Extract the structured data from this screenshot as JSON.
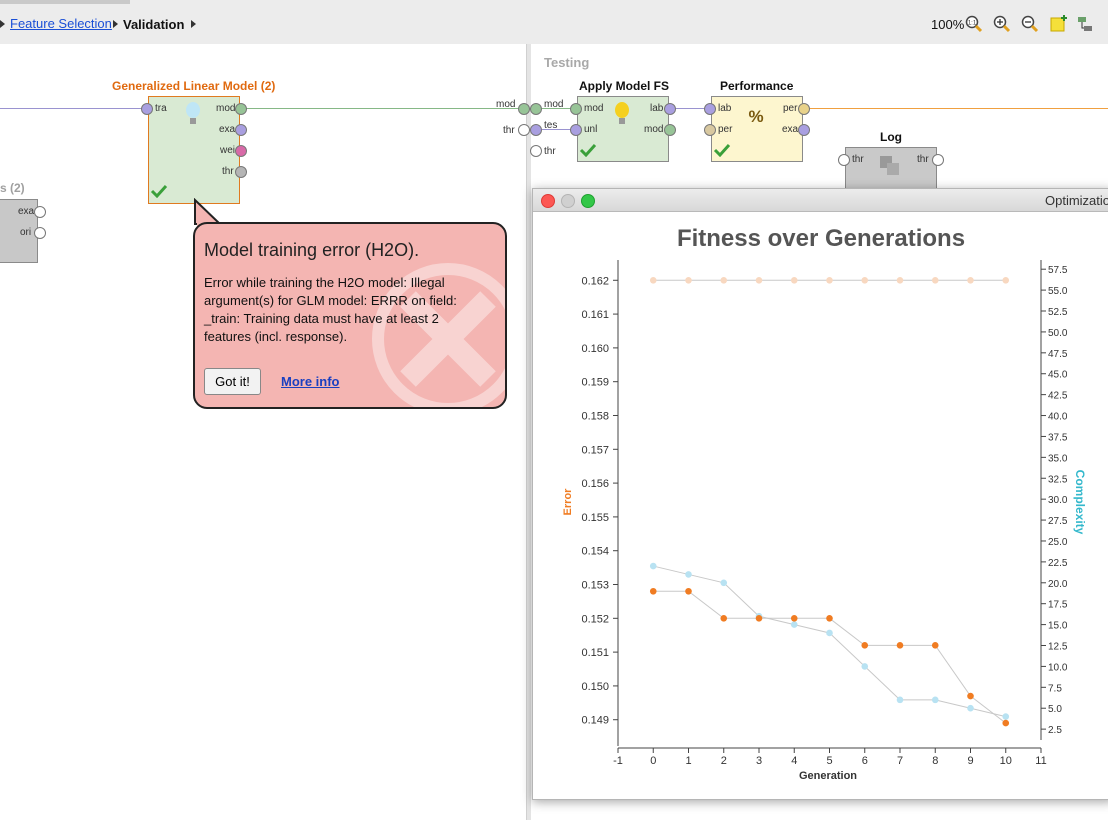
{
  "breadcrumb": {
    "link": "Feature Selection",
    "current": "Validation"
  },
  "toolbar": {
    "zoom": "100%",
    "zoom_badge": "1:1"
  },
  "process": {
    "glm": {
      "label": "Generalized Linear Model (2)",
      "ports_in": [
        "tra"
      ],
      "ports_out": [
        "mod",
        "exa",
        "wei",
        "thr"
      ]
    },
    "partial_left": {
      "label": "s (2)",
      "ports_out": [
        "exa",
        "ori"
      ]
    },
    "testing": {
      "title": "Testing",
      "left_ports_outside": [
        "mod",
        "thr"
      ],
      "left_ports_inside": [
        "mod",
        "tes",
        "thr"
      ]
    },
    "apply_model": {
      "label": "Apply Model FS",
      "ports_in": [
        "mod",
        "unl"
      ],
      "ports_out": [
        "lab",
        "mod"
      ]
    },
    "performance": {
      "label": "Performance",
      "ports_in": [
        "lab",
        "per"
      ],
      "ports_out": [
        "per",
        "exa"
      ]
    },
    "log": {
      "label": "Log",
      "ports_in": [
        "thr"
      ],
      "ports_out": [
        "thr"
      ]
    }
  },
  "error_popup": {
    "title": "Model training error (H2O).",
    "message": "Error while training the H2O model: Illegal argument(s) for GLM model: ERRR on field: _train: Training data must have at least 2 features (incl. response).",
    "button": "Got it!",
    "link": "More info"
  },
  "window": {
    "title": "Optimization"
  },
  "colors": {
    "error": "#f07c22",
    "complexity": "#b8e2f2",
    "constant": "#f8d8c0",
    "complexity_axis": "#33b8cc"
  },
  "chart_data": {
    "type": "line",
    "title": "Fitness over Generations",
    "xlabel": "Generation",
    "ylabel_left": "Error",
    "ylabel_right": "Complexity",
    "xlim": [
      -1,
      11
    ],
    "ylim_left": [
      0.1484,
      0.1626
    ],
    "ylim_right": [
      1.2,
      58.6
    ],
    "x_ticks": [
      -1,
      0,
      1,
      2,
      3,
      4,
      5,
      6,
      7,
      8,
      9,
      10,
      11
    ],
    "y_ticks_left": [
      "0.149",
      "0.150",
      "0.151",
      "0.152",
      "0.153",
      "0.154",
      "0.155",
      "0.156",
      "0.157",
      "0.158",
      "0.159",
      "0.160",
      "0.161",
      "0.162"
    ],
    "y_ticks_right": [
      "2.5",
      "5.0",
      "7.5",
      "10.0",
      "12.5",
      "15.0",
      "17.5",
      "20.0",
      "22.5",
      "25.0",
      "27.5",
      "30.0",
      "32.5",
      "35.0",
      "37.5",
      "40.0",
      "42.5",
      "45.0",
      "47.5",
      "50.0",
      "52.5",
      "55.0",
      "57.5"
    ],
    "x": [
      0,
      1,
      2,
      3,
      4,
      5,
      6,
      7,
      8,
      9,
      10
    ],
    "series": [
      {
        "axis": "left",
        "color": "#f07c22",
        "values": [
          0.1528,
          0.1528,
          0.152,
          0.152,
          0.152,
          0.152,
          0.1512,
          0.1512,
          0.1512,
          0.1497,
          0.1489
        ]
      },
      {
        "axis": "left",
        "color": "#f8d8c0",
        "values": [
          0.162,
          0.162,
          0.162,
          0.162,
          0.162,
          0.162,
          0.162,
          0.162,
          0.162,
          0.162,
          0.162
        ]
      },
      {
        "axis": "right",
        "color": "#b8e2f2",
        "values": [
          22.0,
          21.0,
          20.0,
          16.0,
          15.0,
          14.0,
          10.0,
          6.0,
          6.0,
          5.0,
          4.0
        ]
      }
    ]
  }
}
